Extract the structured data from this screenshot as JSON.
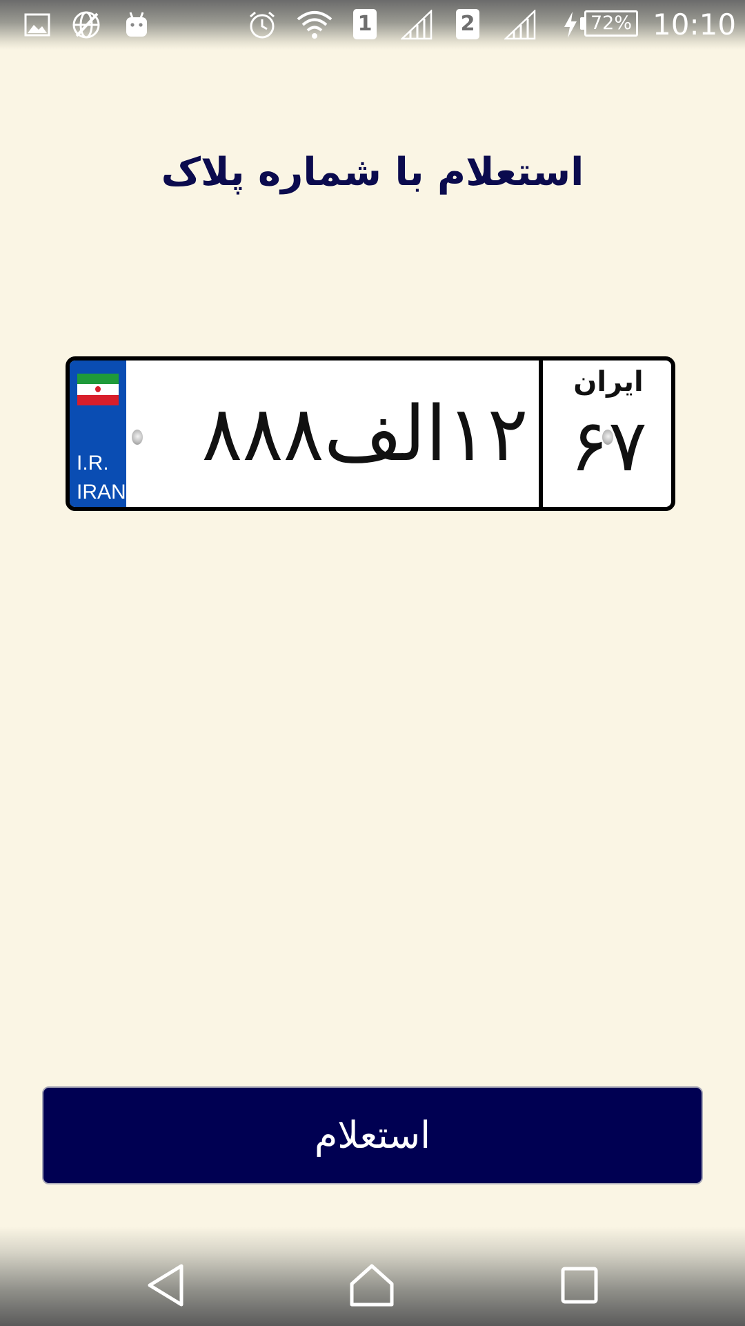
{
  "status_bar": {
    "icons": [
      "gallery-icon",
      "vpn-globe-icon",
      "android-bot-icon",
      "alarm-icon",
      "wifi-icon",
      "signal-icon",
      "signal-icon",
      "charging-icon"
    ],
    "sim1_label": "1",
    "sim2_label": "2",
    "battery": "72%",
    "time": "10:10"
  },
  "header": {
    "title": "استعلام با شماره پلاک"
  },
  "plate": {
    "country_line1": "I.R.",
    "country_line2": "IRAN",
    "main_number": "۱۲الف۸۸۸",
    "region_label": "ایران",
    "region_code": "۶۷",
    "colors": {
      "blue_band": "#0a4db3",
      "flag_green": "#1f9a3a",
      "flag_red": "#d81e2b",
      "plate_background": "#ffffff",
      "border": "#000000"
    }
  },
  "actions": {
    "submit_label": "استعلام"
  },
  "nav_bar": {
    "icons": [
      "back-icon",
      "home-icon",
      "recents-icon"
    ]
  },
  "theme": {
    "background": "#faf5e4",
    "title_color": "#0b0b4e",
    "button_color": "#000052"
  }
}
